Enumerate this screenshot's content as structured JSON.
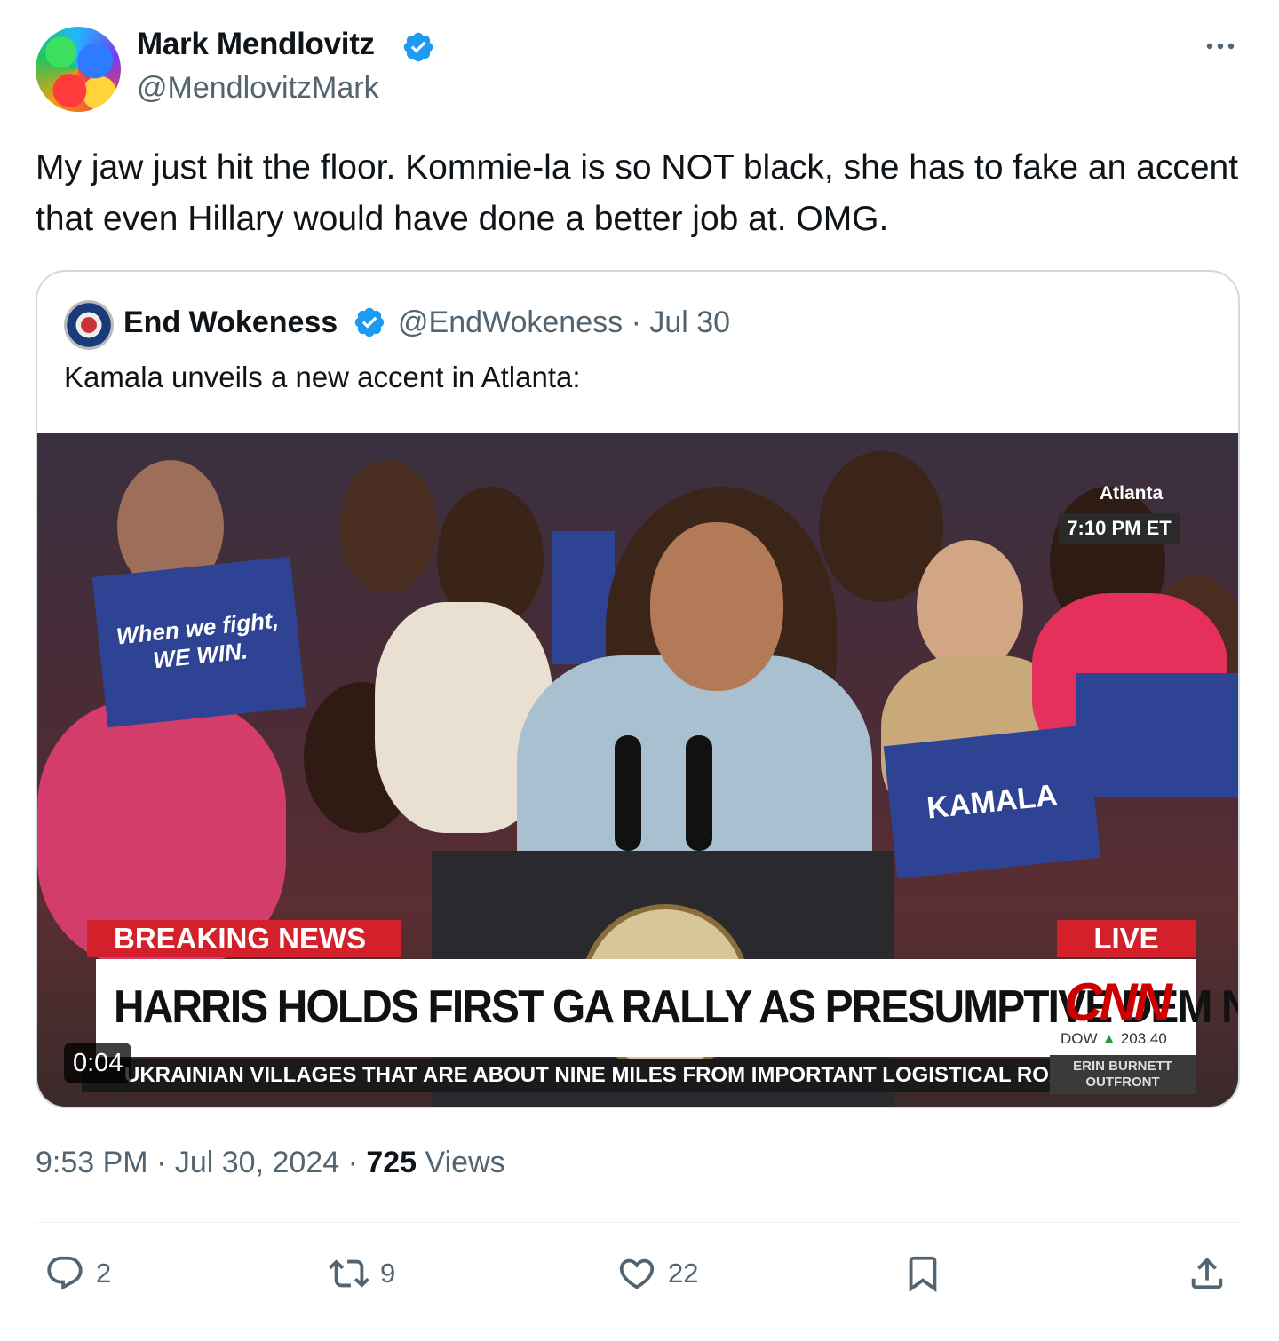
{
  "author": {
    "name": "Mark Mendlovitz",
    "handle": "@MendlovitzMark"
  },
  "tweet": {
    "text": "My jaw just hit the floor. Kommie-la is so NOT black, she has to fake an accent that even Hillary would have done a better job at. OMG."
  },
  "quote": {
    "name": "End Wokeness",
    "handle": "@EndWokeness",
    "date": "Jul 30",
    "text": "Kamala unveils a new accent in Atlanta:",
    "video": {
      "duration": "0:04",
      "location": "Atlanta",
      "time": "7:10 PM ET",
      "breaking": "BREAKING NEWS",
      "live": "LIVE",
      "headline": "HARRIS HOLDS FIRST GA RALLY AS PRESUMPTIVE DEM NOMINEE",
      "network": "CNN",
      "dow": "DOW",
      "dow_value": "203.40",
      "ticker": "UKRAINIAN VILLAGES THAT ARE ABOUT NINE MILES FROM IMPORTANT LOGISTICAL ROA",
      "show": "ERIN BURNETT OUTFRONT",
      "sign_left": "When we fight, WE WIN.",
      "sign_right": "KAMALA"
    }
  },
  "meta": {
    "time": "9:53 PM",
    "date": "Jul 30, 2024",
    "views_count": "725",
    "views_label": "Views"
  },
  "actions": {
    "replies": "2",
    "reposts": "9",
    "likes": "22"
  },
  "colors": {
    "verified": "#1d9bf0",
    "muted_text": "#536471",
    "cnn_red": "#cc0000"
  }
}
